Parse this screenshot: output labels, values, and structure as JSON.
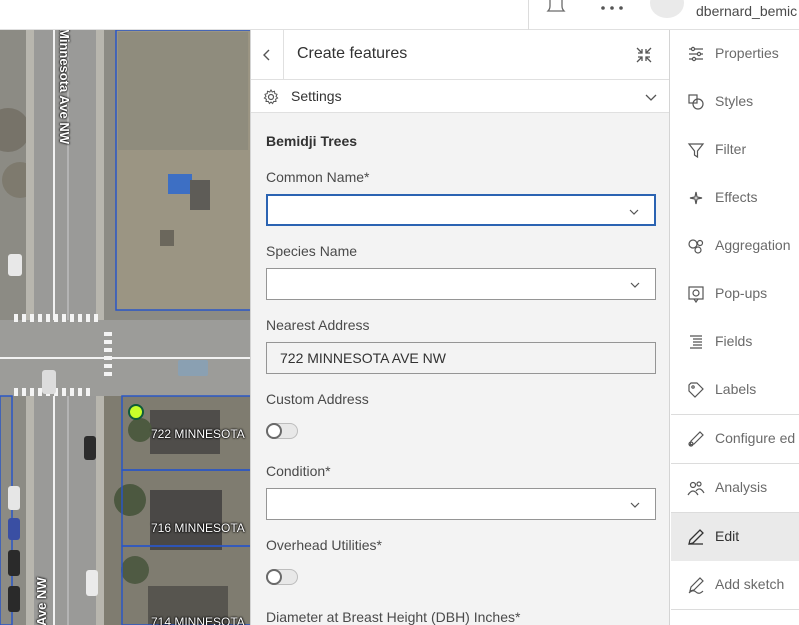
{
  "header": {
    "username": "dbernard_bemic",
    "notifications_icon": "bell-icon",
    "apps_icon": "app-launcher-icon"
  },
  "map": {
    "street_labels": [
      "Minnesota Ave NW",
      "Ave NW"
    ],
    "address_labels": [
      "722 MINNESOTA",
      "716 MINNESOTA",
      "714 MINNESOTA"
    ]
  },
  "panel": {
    "title": "Create features",
    "settings_label": "Settings",
    "layer_name": "Bemidji Trees",
    "fields": {
      "common_name": {
        "label": "Common Name*",
        "value": ""
      },
      "species_name": {
        "label": "Species Name",
        "value": ""
      },
      "nearest_address": {
        "label": "Nearest Address",
        "value": "722 MINNESOTA AVE NW"
      },
      "custom_address": {
        "label": "Custom Address",
        "on": false
      },
      "condition": {
        "label": "Condition*",
        "value": ""
      },
      "overhead_utilities": {
        "label": "Overhead Utilities*",
        "on": false
      },
      "dbh": {
        "label": "Diameter at Breast Height (DBH) Inches*"
      }
    }
  },
  "actions": [
    {
      "label": "Properties",
      "icon": "properties-icon",
      "active": false
    },
    {
      "label": "Styles",
      "icon": "styles-icon",
      "active": false
    },
    {
      "label": "Filter",
      "icon": "filter-icon",
      "active": false
    },
    {
      "label": "Effects",
      "icon": "effects-icon",
      "active": false
    },
    {
      "label": "Aggregation",
      "icon": "aggregation-icon",
      "active": false
    },
    {
      "label": "Pop-ups",
      "icon": "popups-icon",
      "active": false
    },
    {
      "label": "Fields",
      "icon": "fields-icon",
      "active": false
    },
    {
      "label": "Labels",
      "icon": "labels-icon",
      "active": false
    },
    {
      "label": "Configure ed",
      "icon": "configure-editing-icon",
      "active": false
    },
    {
      "label": "Analysis",
      "icon": "analysis-icon",
      "active": false
    },
    {
      "label": "Edit",
      "icon": "edit-icon",
      "active": true
    },
    {
      "label": "Add sketch",
      "icon": "sketch-icon",
      "active": false
    }
  ],
  "colors": {
    "focus_border": "#2b63b2",
    "point_marker": "#c8ff2a",
    "parcel_line": "#2a56c6"
  }
}
